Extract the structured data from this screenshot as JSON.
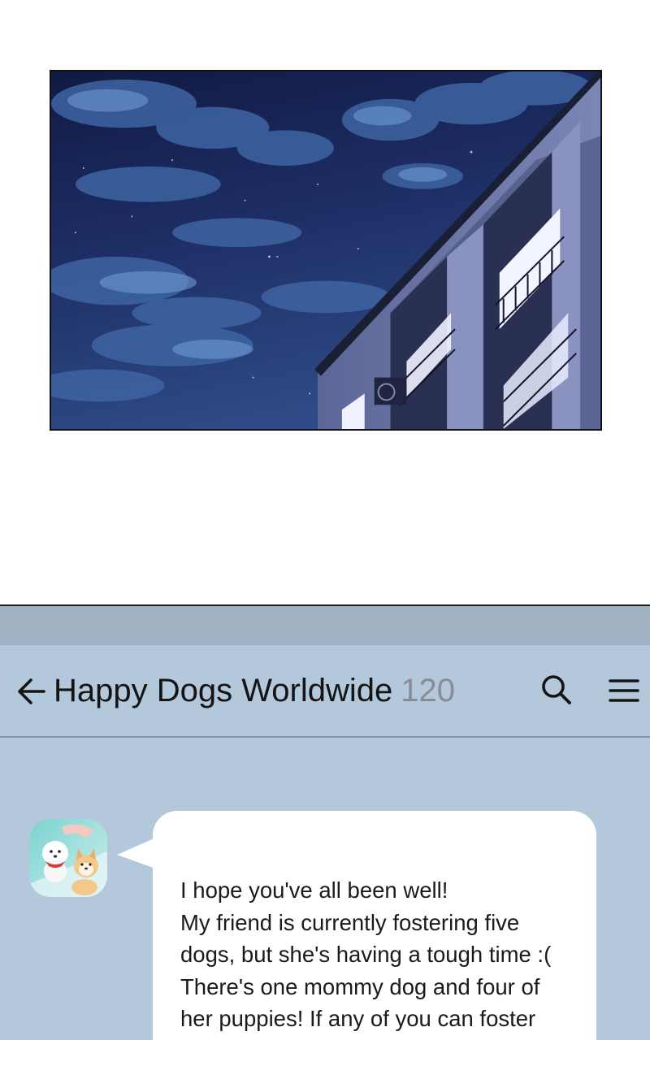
{
  "chat": {
    "title": "Happy Dogs Worldwide",
    "member_count": "120",
    "icons": {
      "back": "arrow-left-icon",
      "search": "search-icon",
      "menu": "hamburger-menu-icon"
    },
    "message": {
      "lines": [
        "I hope you've all been well!",
        "My friend is currently fostering five",
        "dogs, but she's having a tough time :(",
        "There's one mommy dog and four of",
        "her puppies!  If any of you can foster"
      ]
    }
  },
  "colors": {
    "chat_background": "#b4c8dc",
    "status_strip": "#a0b1c4",
    "bubble": "#ffffff",
    "count_text": "#878d95",
    "night_sky": "#1b2a5a"
  }
}
